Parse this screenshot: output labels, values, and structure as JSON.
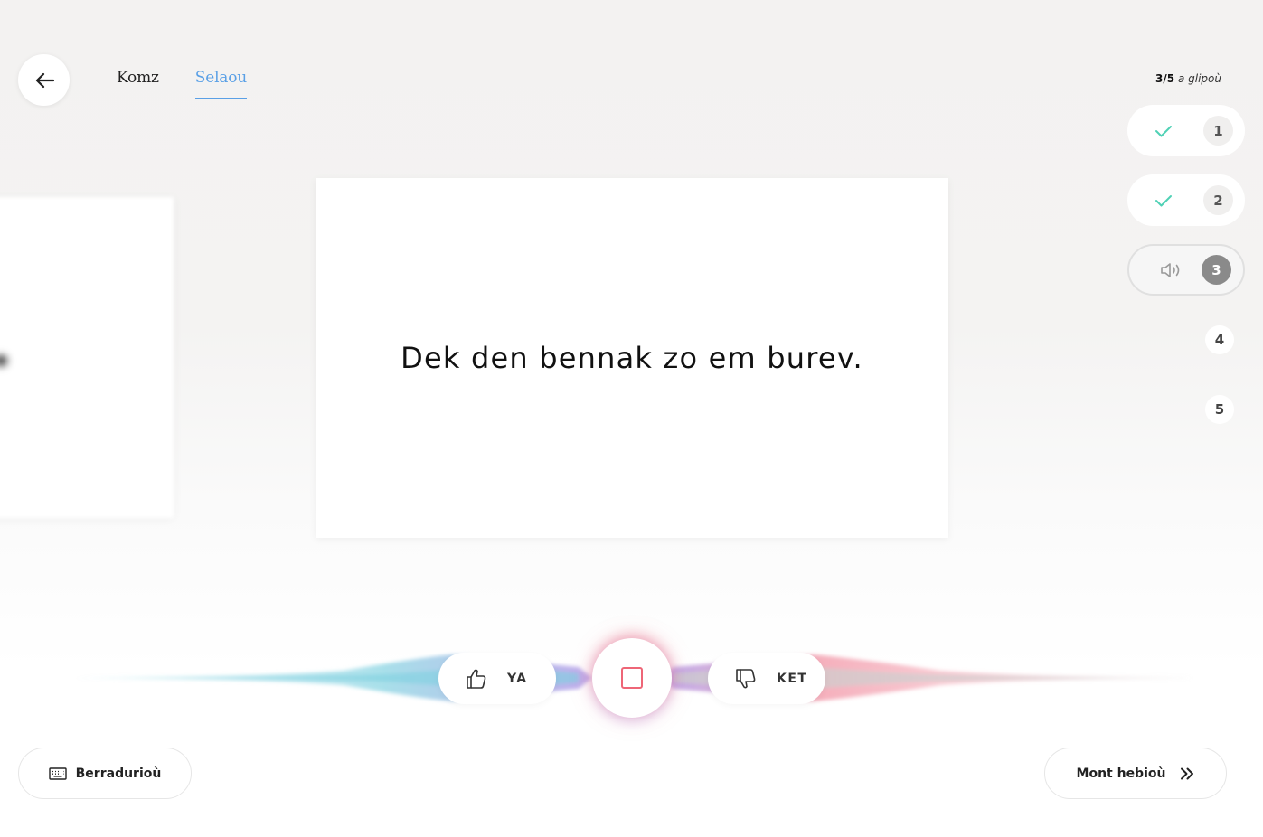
{
  "nav": {
    "back_icon": "arrow-left-icon",
    "tabs": [
      {
        "label": "Komz",
        "active": false
      },
      {
        "label": "Selaou",
        "active": true
      }
    ]
  },
  "card": {
    "sentence": "Dek den bennak zo em burev."
  },
  "progress": {
    "current": "3/5",
    "suffix": "a glipoù",
    "steps": [
      {
        "number": "1",
        "status": "done",
        "icon": "check-icon"
      },
      {
        "number": "2",
        "status": "done",
        "icon": "check-icon"
      },
      {
        "number": "3",
        "status": "current",
        "icon": "speaker-icon"
      },
      {
        "number": "4",
        "status": "pending"
      },
      {
        "number": "5",
        "status": "pending"
      }
    ]
  },
  "controls": {
    "yes_label": "YA",
    "no_label": "KET",
    "record_icon": "stop-square-icon"
  },
  "footer": {
    "shortcuts_label": "Berradurioù",
    "skip_label": "Mont hebioù"
  },
  "colors": {
    "accent": "#5aa0e6",
    "check": "#4fd1b5",
    "record": "#ee6677"
  }
}
